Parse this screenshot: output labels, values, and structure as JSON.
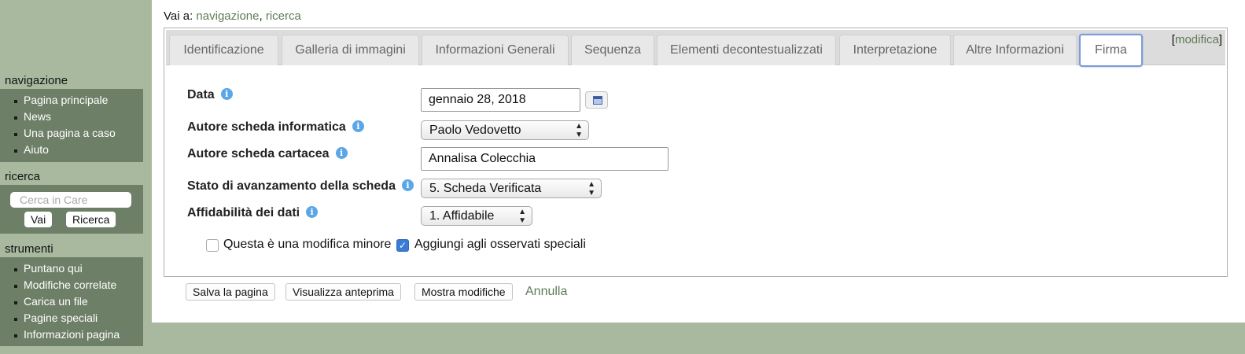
{
  "sidebar": {
    "navigation": {
      "heading": "navigazione",
      "items": [
        "Pagina principale",
        "News",
        "Una pagina a caso",
        "Aiuto"
      ]
    },
    "search": {
      "heading": "ricerca",
      "placeholder": "Cerca in Care",
      "go_label": "Vai",
      "search_label": "Ricerca"
    },
    "tools": {
      "heading": "strumenti",
      "items": [
        "Puntano qui",
        "Modifiche correlate",
        "Carica un file",
        "Pagine speciali",
        "Informazioni pagina"
      ]
    }
  },
  "jump": {
    "prefix": "Vai a:",
    "nav_link": "navigazione",
    "separator": ",",
    "search_link": "ricerca"
  },
  "tabs": [
    {
      "label": "Identificazione"
    },
    {
      "label": "Galleria di immagini"
    },
    {
      "label": "Informazioni Generali"
    },
    {
      "label": "Sequenza"
    },
    {
      "label": "Elementi decontestualizzati"
    },
    {
      "label": "Interpretazione"
    },
    {
      "label": "Altre Informazioni"
    },
    {
      "label": "Firma",
      "active": true
    }
  ],
  "edit_link": {
    "open": "[",
    "label": "modifica",
    "close": "]"
  },
  "form": {
    "data": {
      "label": "Data",
      "value": "gennaio 28, 2018"
    },
    "autore_informatica": {
      "label": "Autore scheda informatica",
      "value": "Paolo Vedovetto"
    },
    "autore_cartacea": {
      "label": "Autore scheda cartacea",
      "value": "Annalisa Colecchia"
    },
    "stato": {
      "label": "Stato di avanzamento della scheda",
      "value": "5. Scheda Verificata"
    },
    "affidabilita": {
      "label": "Affidabilità dei dati",
      "value": "1. Affidabile"
    },
    "info_glyph": "i",
    "minor_edit": {
      "label": "Questa è una modifica minore",
      "checked": false
    },
    "watch": {
      "label": "Aggiungi agli osservati speciali",
      "checked": true
    }
  },
  "actions": {
    "save": "Salva la pagina",
    "preview": "Visualizza anteprima",
    "diff": "Mostra modifiche",
    "cancel": "Annulla"
  },
  "colors": {
    "background": "#a8b9a0",
    "sidebar_panel": "#6e7f67",
    "link": "#5f7c55",
    "active_tab_border": "#7e9ad8",
    "info_icon": "#5ba6e6",
    "checkbox_checked": "#3a7bd5"
  },
  "icons": {
    "info": "info-icon",
    "calendar": "calendar-icon",
    "select_arrows": "up-down-arrows-icon",
    "check": "checkmark-icon"
  }
}
